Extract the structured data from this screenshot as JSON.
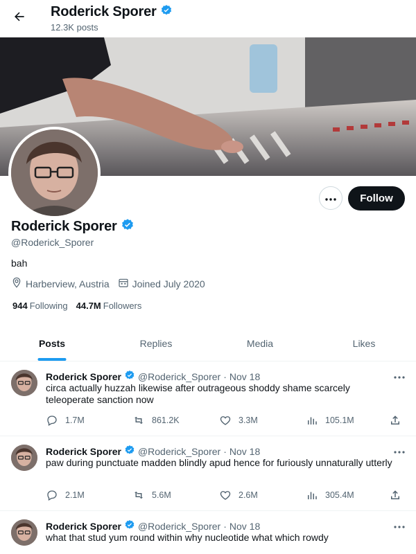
{
  "header": {
    "back_icon": "arrow-left-icon",
    "name": "Roderick Sporer",
    "post_count": "12.3K posts"
  },
  "profile": {
    "name": "Roderick Sporer",
    "handle": "@Roderick_Sporer",
    "bio": "bah",
    "location": "Harberview, Austria",
    "joined": "Joined July 2020",
    "following_count": "944",
    "following_label": "Following",
    "followers_count": "44.7M",
    "followers_label": "Followers",
    "follow_label": "Follow",
    "verified_color": "#1d9bf0"
  },
  "tabs": [
    {
      "label": "Posts",
      "active": true
    },
    {
      "label": "Replies",
      "active": false
    },
    {
      "label": "Media",
      "active": false
    },
    {
      "label": "Likes",
      "active": false
    }
  ],
  "posts": [
    {
      "name": "Roderick Sporer",
      "handle": "@Roderick_Sporer",
      "dot": "·",
      "date": "Nov 18",
      "text": "circa actually huzzah likewise after outrageous shoddy shame scarcely teleoperate sanction now",
      "replies": "1.7M",
      "reposts": "861.2K",
      "likes": "3.3M",
      "views": "105.1M"
    },
    {
      "name": "Roderick Sporer",
      "handle": "@Roderick_Sporer",
      "dot": "·",
      "date": "Nov 18",
      "text": "paw during punctuate madden blindly apud hence for furiously unnaturally utterly",
      "replies": "2.1M",
      "reposts": "5.6M",
      "likes": "2.6M",
      "views": "305.4M"
    },
    {
      "name": "Roderick Sporer",
      "handle": "@Roderick_Sporer",
      "dot": "·",
      "date": "Nov 18",
      "text": "what that stud yum round within why nucleotide what which rowdy",
      "replies": "",
      "reposts": "",
      "likes": "",
      "views": ""
    }
  ],
  "colors": {
    "accent": "#1d9bf0",
    "text": "#0f1419",
    "muted": "#536471"
  }
}
